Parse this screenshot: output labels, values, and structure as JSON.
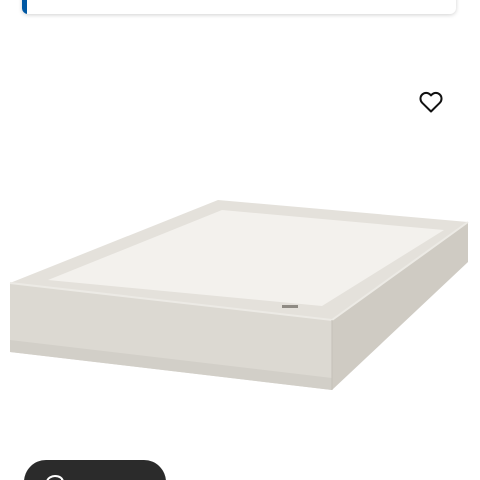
{
  "product": {
    "image_alt": "Box spring base",
    "colors": {
      "frame": "#dddad4",
      "frame_shadow": "#c9c5bd",
      "top_panel": "#f1efea",
      "accent_blue": "#0058a3",
      "pill_bg": "#2b2b2b"
    }
  },
  "icons": {
    "favourite": "heart-icon",
    "pill": "rotate-3d-icon"
  },
  "bottom_pill": {
    "label": ""
  }
}
